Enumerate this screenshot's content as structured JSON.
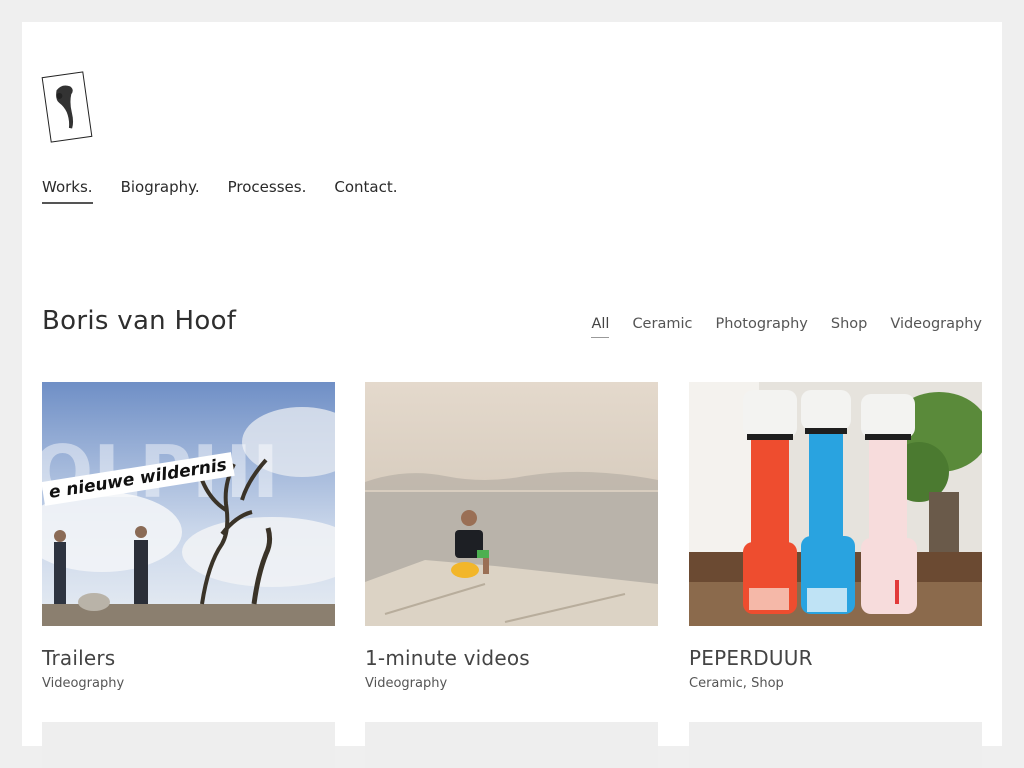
{
  "nav": {
    "items": [
      "Works.",
      "Biography.",
      "Processes.",
      "Contact."
    ]
  },
  "header": {
    "title": "Boris van Hoof"
  },
  "filters": [
    "All",
    "Ceramic",
    "Photography",
    "Shop",
    "Videography"
  ],
  "works": [
    {
      "title": "Trailers",
      "categories": "Videography",
      "overlay_text": "e nieuwe wildernis"
    },
    {
      "title": "1-minute videos",
      "categories": "Videography"
    },
    {
      "title": "PEPERDUUR",
      "categories": "Ceramic, Shop"
    }
  ],
  "colors": {
    "background": "#efefef",
    "page": "#ffffff",
    "text": "#333333"
  }
}
